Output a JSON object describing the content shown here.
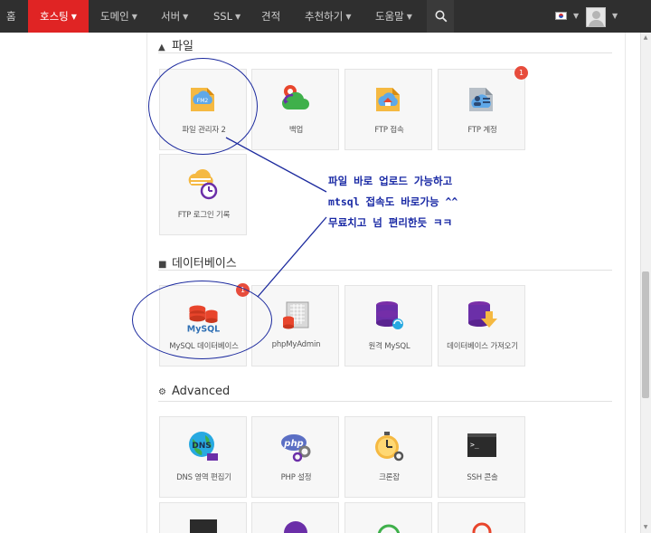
{
  "nav": {
    "items": [
      {
        "label": "홈",
        "dropdown": false
      },
      {
        "label": "호스팅",
        "dropdown": true,
        "active": true
      },
      {
        "label": "도메인",
        "dropdown": true
      },
      {
        "label": "서버",
        "dropdown": true
      },
      {
        "label": "SSL",
        "dropdown": true
      },
      {
        "label": "견적",
        "dropdown": false
      },
      {
        "label": "추천하기",
        "dropdown": true
      },
      {
        "label": "도움말",
        "dropdown": true
      }
    ],
    "active_color": "#e02424"
  },
  "sections": {
    "files": {
      "title": "파일",
      "tiles": [
        {
          "label": "파일 관리자 2",
          "icon": "file-manager-icon"
        },
        {
          "label": "백업",
          "icon": "backup-icon"
        },
        {
          "label": "FTP 접속",
          "icon": "ftp-access-icon"
        },
        {
          "label": "FTP 계정",
          "icon": "ftp-account-icon",
          "badge": "1"
        },
        {
          "label": "FTP 로그인 기록",
          "icon": "ftp-login-history-icon"
        }
      ]
    },
    "database": {
      "title": "데이터베이스",
      "tiles": [
        {
          "label": "MySQL 데이터베이스",
          "icon": "mysql-icon",
          "badge": "1",
          "icon_text": "MySQL"
        },
        {
          "label": "phpMyAdmin",
          "icon": "phpmyadmin-icon"
        },
        {
          "label": "원격 MySQL",
          "icon": "remote-mysql-icon"
        },
        {
          "label": "데이터베이스 가져오기",
          "icon": "database-import-icon"
        }
      ]
    },
    "advanced": {
      "title": "Advanced",
      "tiles": [
        {
          "label": "DNS 영역 편집기",
          "icon": "dns-icon",
          "icon_text": "DNS"
        },
        {
          "label": "PHP 설정",
          "icon": "php-icon",
          "icon_text": "php"
        },
        {
          "label": "크론잡",
          "icon": "cron-icon"
        },
        {
          "label": "SSH 콘솔",
          "icon": "ssh-icon",
          "icon_text": ">_"
        }
      ]
    }
  },
  "annotation": {
    "lines": [
      "파일 바로 업로드 가능하고",
      "mtsql 접속도 바로가능 ^^",
      "무료치고 넘 편리한듯 ㅋㅋ"
    ],
    "color": "#1a2aa5"
  }
}
